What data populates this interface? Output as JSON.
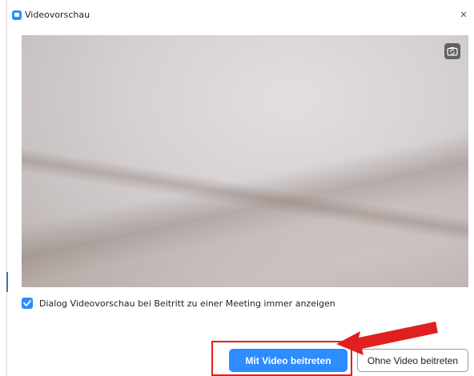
{
  "window": {
    "title": "Videovorschau",
    "close_glyph": "×",
    "icon": "zoom-video-icon"
  },
  "preview": {
    "camera_switch_icon": "camera-switch-icon"
  },
  "options": {
    "always_show_preview_label": "Dialog Videovorschau bei Beitritt zu einer Meeting immer anzeigen",
    "always_show_preview_checked": true
  },
  "actions": {
    "join_with_video_label": "Mit Video beitreten",
    "join_without_video_label": "Ohne Video beitreten"
  },
  "annotation": {
    "highlight_color": "#e02020"
  },
  "colors": {
    "accent": "#2d8cff"
  }
}
